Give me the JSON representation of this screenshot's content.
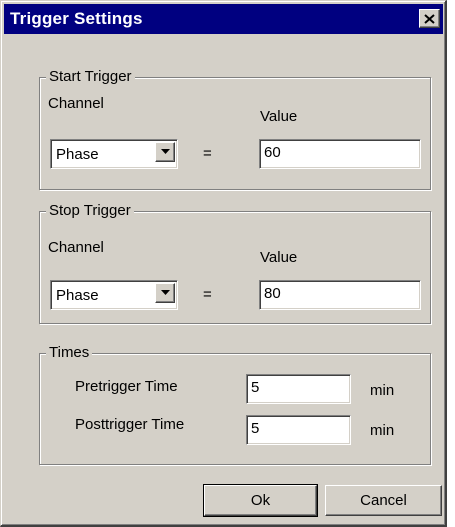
{
  "dialog": {
    "title": "Trigger Settings",
    "close_icon": "close-x-icon"
  },
  "start_trigger": {
    "legend": "Start Trigger",
    "channel_label": "Channel",
    "value_label": "Value",
    "channel_selected": "Phase",
    "equals": "=",
    "value": "60"
  },
  "stop_trigger": {
    "legend": "Stop Trigger",
    "channel_label": "Channel",
    "value_label": "Value",
    "channel_selected": "Phase",
    "equals": "=",
    "value": "80"
  },
  "times": {
    "legend": "Times",
    "pretrigger_label": "Pretrigger Time",
    "pretrigger_value": "5",
    "pretrigger_unit": "min",
    "posttrigger_label": "Posttrigger Time",
    "posttrigger_value": "5",
    "posttrigger_unit": "min"
  },
  "buttons": {
    "ok": "Ok",
    "cancel": "Cancel"
  },
  "colors": {
    "titlebar": "#000080",
    "face": "#d4d0c8"
  }
}
